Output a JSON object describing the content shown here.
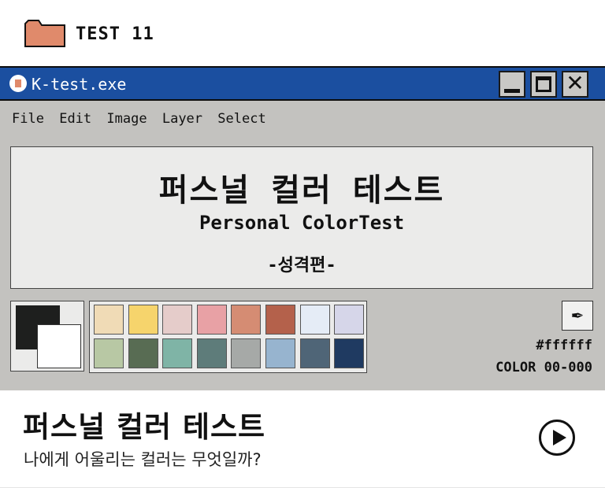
{
  "header": {
    "label": "TEST 11",
    "folder_icon": "folder-icon",
    "folder_color": "#e08a6b"
  },
  "window": {
    "title": "K-test.exe",
    "titlebar_color": "#1b4fa0",
    "buttons": [
      "minimize",
      "maximize",
      "close"
    ],
    "close_glyph": "✕"
  },
  "menu": {
    "items": [
      "File",
      "Edit",
      "Image",
      "Layer",
      "Select"
    ]
  },
  "canvas": {
    "title": "퍼스널 컬러 테스트",
    "subtitle": "Personal ColorTest",
    "edition": "-성격편-"
  },
  "swatches": {
    "foreground": "#1e1f1e",
    "background": "#ffffff"
  },
  "palette": {
    "colors": [
      "#f0dbb6",
      "#f6d46c",
      "#e5ccca",
      "#e8a1a5",
      "#d58c73",
      "#b4614b",
      "#e5ecf6",
      "#d6d6e9",
      "#b8c8a4",
      "#586c53",
      "#7fb4a6",
      "#5e7c7a",
      "#a6a9a7",
      "#97b4cf",
      "#4f6577",
      "#1f3a61"
    ]
  },
  "tools": {
    "eyedropper_glyph": "✒",
    "hex_value": "#ffffff",
    "color_code": "COLOR 00-000"
  },
  "info": {
    "title": "퍼스널 컬러 테스트",
    "subtitle": "나에게 어울리는 컬러는 무엇일까?"
  }
}
